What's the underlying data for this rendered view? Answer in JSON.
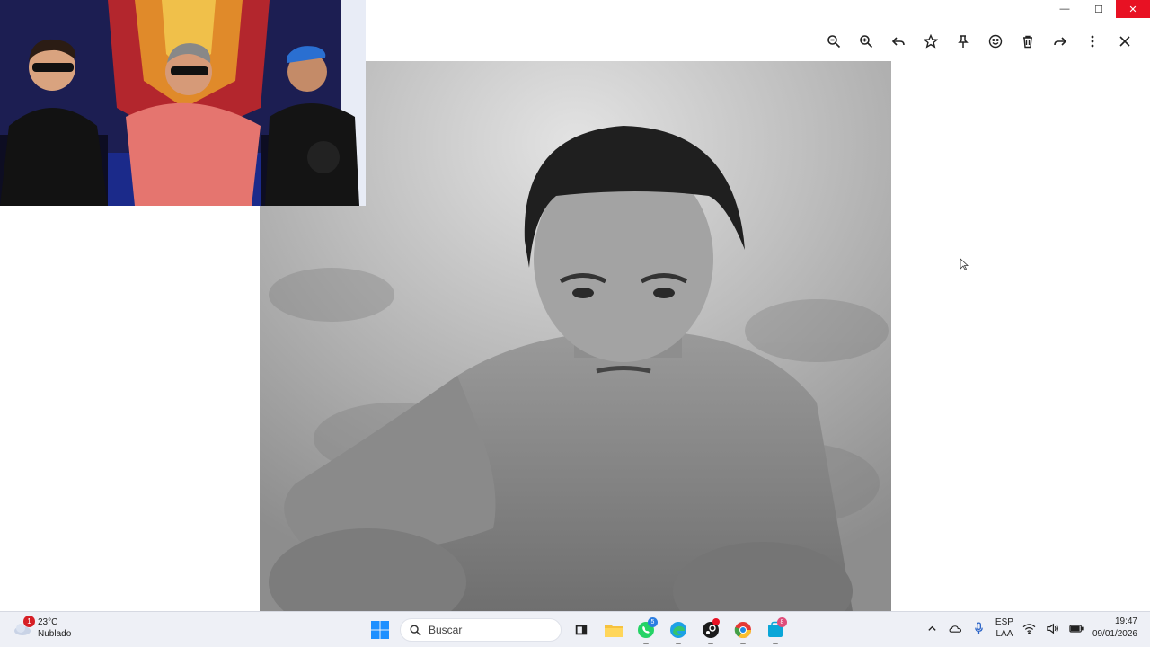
{
  "window": {
    "caption": {
      "minimize": "—",
      "maximize": "☐",
      "close": "✕"
    }
  },
  "toolbar": {
    "icons": [
      "zoom-out-icon",
      "zoom-in-icon",
      "reply-icon",
      "star-icon",
      "pin-icon",
      "emoji-icon",
      "trash-icon",
      "forward-icon",
      "more-vertical-icon",
      "close-icon"
    ]
  },
  "taskbar": {
    "weather": {
      "temp": "23°C",
      "condition": "Nublado",
      "badge": "1"
    },
    "search": {
      "label": "Buscar"
    },
    "apps": {
      "whatsapp_badge": "5",
      "teams_badge": "8"
    },
    "tray": {
      "lang_line1": "ESP",
      "lang_line2": "LAA"
    },
    "clock": {
      "time": "19:47",
      "date": "09/01/2026"
    }
  },
  "colors": {
    "close_red": "#e81123",
    "taskbar_bg": "#eef0f6",
    "badge_red": "#d61f26"
  }
}
